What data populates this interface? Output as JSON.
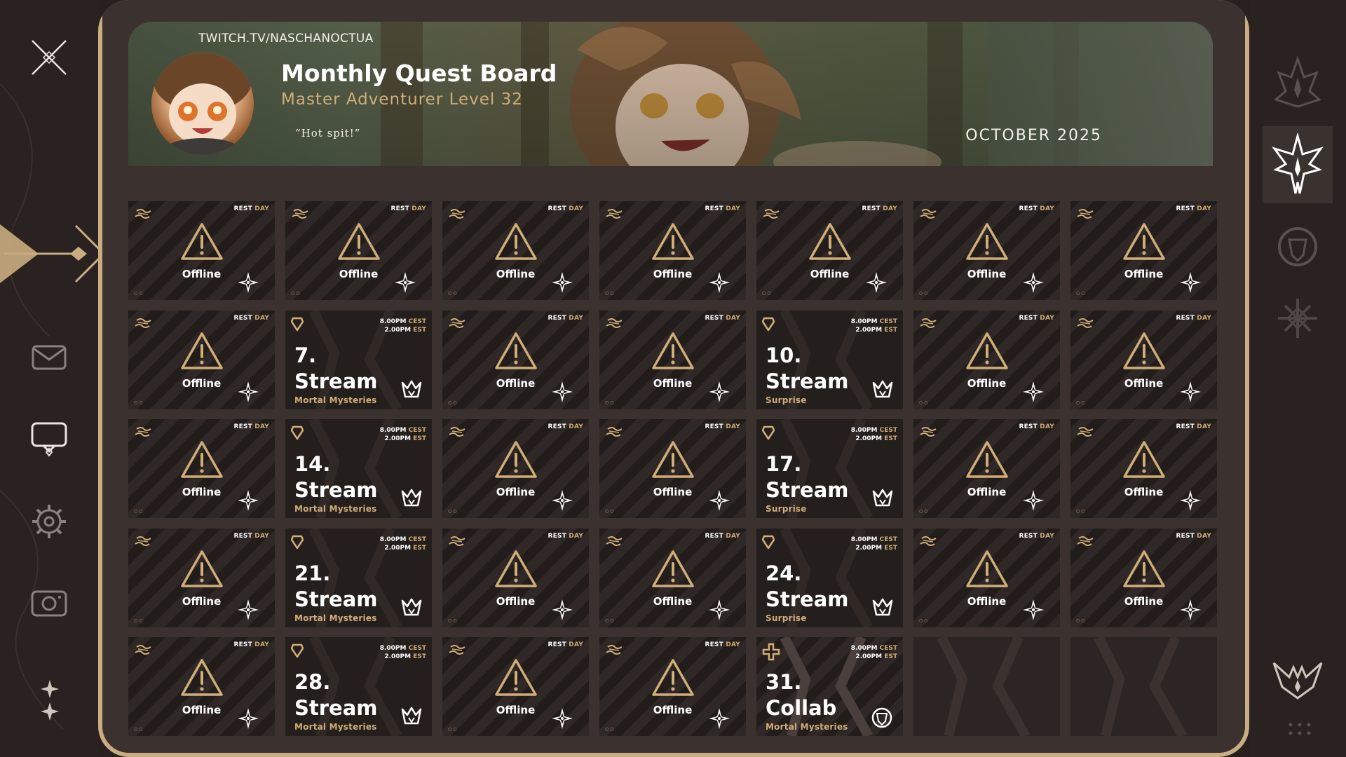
{
  "colors": {
    "accent": "#cfae79",
    "frame": "#c9ad80",
    "panel": "#3a312e",
    "cell_dark": "#221c1a"
  },
  "header": {
    "channel_url": "TWITCH.TV/NASCHANOCTUA",
    "title": "Monthly Quest Board",
    "subtitle": "Master Adventurer Level 32",
    "quote": "“Hot spit!”",
    "month": "OCTOBER 2025"
  },
  "left_nav": [
    {
      "icon": "close-icon"
    },
    {
      "icon": "mail-icon"
    },
    {
      "icon": "chat-bubble-icon"
    },
    {
      "icon": "gear-icon"
    },
    {
      "icon": "camera-icon"
    }
  ],
  "right_nav": [
    {
      "icon": "flame-crest-icon",
      "active": false
    },
    {
      "icon": "winged-crest-icon",
      "active": true
    },
    {
      "icon": "shield-crest-icon",
      "active": false
    },
    {
      "icon": "ornament-crest-icon",
      "active": false
    },
    {
      "icon": "bird-crest-icon",
      "active": false
    }
  ],
  "labels": {
    "rest": "REST",
    "day": "DAY",
    "offline": "Offline",
    "time_cest": "8.00PM",
    "tz_cest": "CEST",
    "time_est": "2.00PM",
    "tz_est": "EST"
  },
  "days": [
    {
      "type": "rest"
    },
    {
      "type": "rest"
    },
    {
      "type": "rest"
    },
    {
      "type": "rest"
    },
    {
      "type": "rest"
    },
    {
      "type": "rest"
    },
    {
      "type": "rest"
    },
    {
      "type": "rest"
    },
    {
      "type": "stream",
      "num": "7.",
      "kind": "Stream",
      "sub": "Mortal Mysteries"
    },
    {
      "type": "rest"
    },
    {
      "type": "rest"
    },
    {
      "type": "stream",
      "num": "10.",
      "kind": "Stream",
      "sub": "Surprise"
    },
    {
      "type": "rest"
    },
    {
      "type": "rest"
    },
    {
      "type": "rest"
    },
    {
      "type": "stream",
      "num": "14.",
      "kind": "Stream",
      "sub": "Mortal Mysteries"
    },
    {
      "type": "rest"
    },
    {
      "type": "rest"
    },
    {
      "type": "stream",
      "num": "17.",
      "kind": "Stream",
      "sub": "Surprise"
    },
    {
      "type": "rest"
    },
    {
      "type": "rest"
    },
    {
      "type": "rest"
    },
    {
      "type": "stream",
      "num": "21.",
      "kind": "Stream",
      "sub": "Mortal Mysteries"
    },
    {
      "type": "rest"
    },
    {
      "type": "rest"
    },
    {
      "type": "stream",
      "num": "24.",
      "kind": "Stream",
      "sub": "Surprise"
    },
    {
      "type": "rest"
    },
    {
      "type": "rest"
    },
    {
      "type": "rest"
    },
    {
      "type": "stream",
      "num": "28.",
      "kind": "Stream",
      "sub": "Mortal Mysteries"
    },
    {
      "type": "rest"
    },
    {
      "type": "rest"
    },
    {
      "type": "collab",
      "num": "31.",
      "kind": "Collab",
      "sub": "Mortal Mysteries"
    },
    {
      "type": "empty"
    },
    {
      "type": "empty"
    }
  ]
}
